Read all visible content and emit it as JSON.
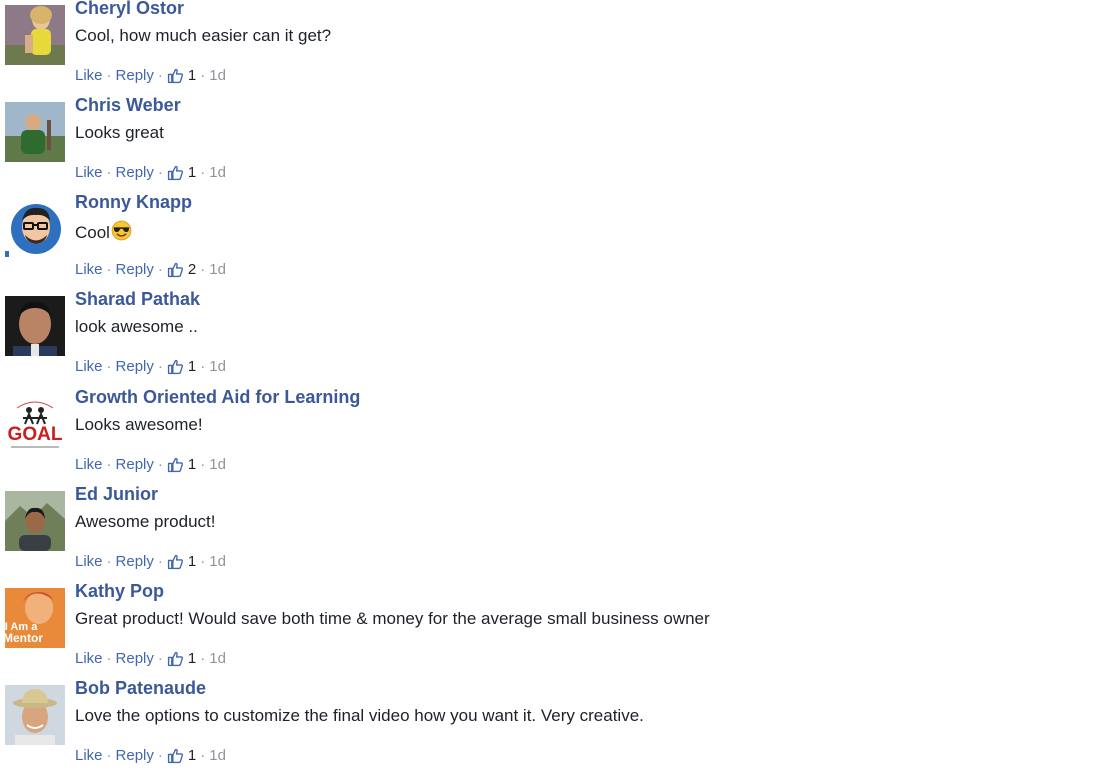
{
  "comments": [
    {
      "author": "Cheryl Ostor",
      "text": "Cool, how much easier can it get?",
      "like": "Like",
      "reply": "Reply",
      "reactions": "1",
      "time": "1d",
      "avatar": "photo-woman-yellow-top"
    },
    {
      "author": "Chris Weber",
      "text": "Looks great",
      "like": "Like",
      "reply": "Reply",
      "reactions": "1",
      "time": "1d",
      "avatar": "photo-man-outdoors"
    },
    {
      "author": "Ronny Knapp",
      "text": "Cool",
      "emoji": "smiling-face-with-sunglasses-icon",
      "like": "Like",
      "reply": "Reply",
      "reactions": "2",
      "time": "1d",
      "avatar": "cartoon-man-glasses"
    },
    {
      "author": "Sharad Pathak",
      "text": "look awesome ..",
      "like": "Like",
      "reply": "Reply",
      "reactions": "1",
      "time": "1d",
      "avatar": "photo-man-portrait"
    },
    {
      "author": "Growth Oriented Aid for Learning",
      "text": "Looks awesome!",
      "like": "Like",
      "reply": "Reply",
      "reactions": "1",
      "time": "1d",
      "avatar": "goal-logo",
      "avatar_text": "GOAL"
    },
    {
      "author": "Ed Junior",
      "text": "Awesome product!",
      "like": "Like",
      "reply": "Reply",
      "reactions": "1",
      "time": "1d",
      "avatar": "photo-man-landscape"
    },
    {
      "author": "Kathy Pop",
      "text": "Great product! Would save both time & money for the average small business owner",
      "like": "Like",
      "reply": "Reply",
      "reactions": "1",
      "time": "1d",
      "avatar": "i-am-a-mentor-badge",
      "avatar_text_1": "I Am a",
      "avatar_text_2": "Mentor"
    },
    {
      "author": "Bob Patenaude",
      "text": "Love the options to customize the final video how you want it. Very creative.",
      "like": "Like",
      "reply": "Reply",
      "reactions": "1",
      "time": "1d",
      "avatar": "photo-man-hat"
    }
  ],
  "colors": {
    "author": "#3b5998",
    "link": "#4267b2",
    "meta": "#90949c",
    "text": "#1d2129"
  }
}
